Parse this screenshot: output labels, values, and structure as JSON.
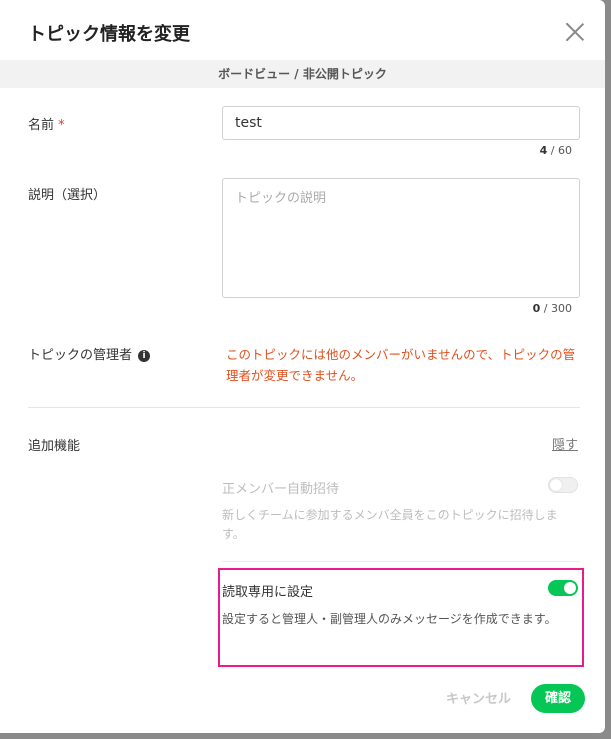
{
  "dialog": {
    "title": "トピック情報を変更",
    "subtitle": "ボードビュー / 非公開トピック"
  },
  "name_field": {
    "label": "名前",
    "required_mark": "*",
    "value": "test",
    "count": "4",
    "max": " / 60"
  },
  "description_field": {
    "label": "説明（選択）",
    "placeholder": "トピックの説明",
    "count": "0",
    "max": " / 300"
  },
  "manager": {
    "label": "トピックの管理者",
    "info_icon": "info-icon",
    "warning": "このトピックには他のメンバーがいませんので、トピックの管理者が変更できません。"
  },
  "extra": {
    "label": "追加機能",
    "hide_label": "隠す",
    "auto_invite": {
      "title": "正メンバー自動招待",
      "description": "新しくチームに参加するメンバ全員をこのトピックに招待します。",
      "enabled": false
    },
    "read_only": {
      "title": "読取専用に設定",
      "description": "設定すると管理人・副管理人のみメッセージを作成できます。",
      "enabled": true
    }
  },
  "footer": {
    "cancel_label": "キャンセル",
    "confirm_label": "確認"
  },
  "colors": {
    "accent": "#06c755",
    "warning": "#e0501e",
    "highlight": "#e81c8b"
  }
}
